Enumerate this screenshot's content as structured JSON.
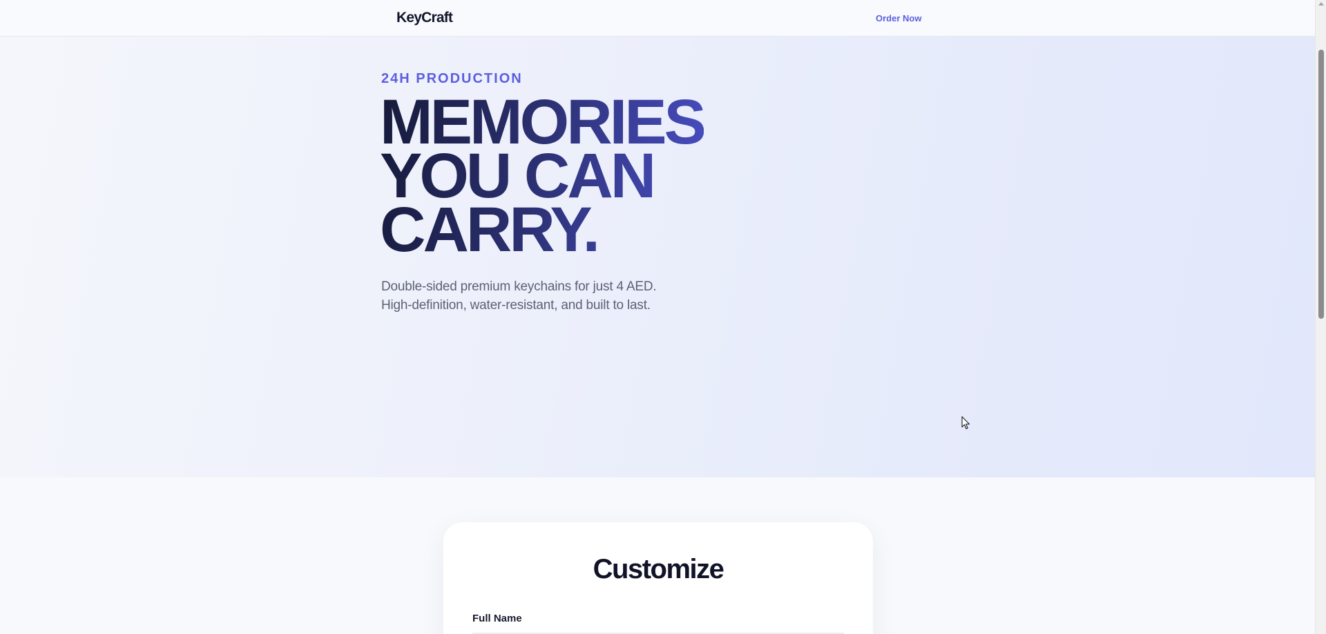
{
  "nav": {
    "brand": "KeyCraft",
    "cta_label": "Order Now"
  },
  "hero": {
    "eyebrow": "24H PRODUCTION",
    "headline": [
      "MEMORIES",
      "YOU CAN",
      "CARRY."
    ],
    "subtext_lines": [
      "Double-sided premium keychains for just 4 AED.",
      "High-definition, water-resistant, and built to last."
    ]
  },
  "customize": {
    "title": "Customize",
    "fields": [
      {
        "label": "Full Name"
      }
    ]
  },
  "colors": {
    "accent": "#5b5ee0",
    "headline_dark": "#161a3a",
    "headline_light": "#4a4fc6",
    "text_muted": "#5c6074"
  },
  "icons": {
    "cursor": "mouse-pointer-icon",
    "scroll_up": "scroll-up-arrow-icon"
  }
}
